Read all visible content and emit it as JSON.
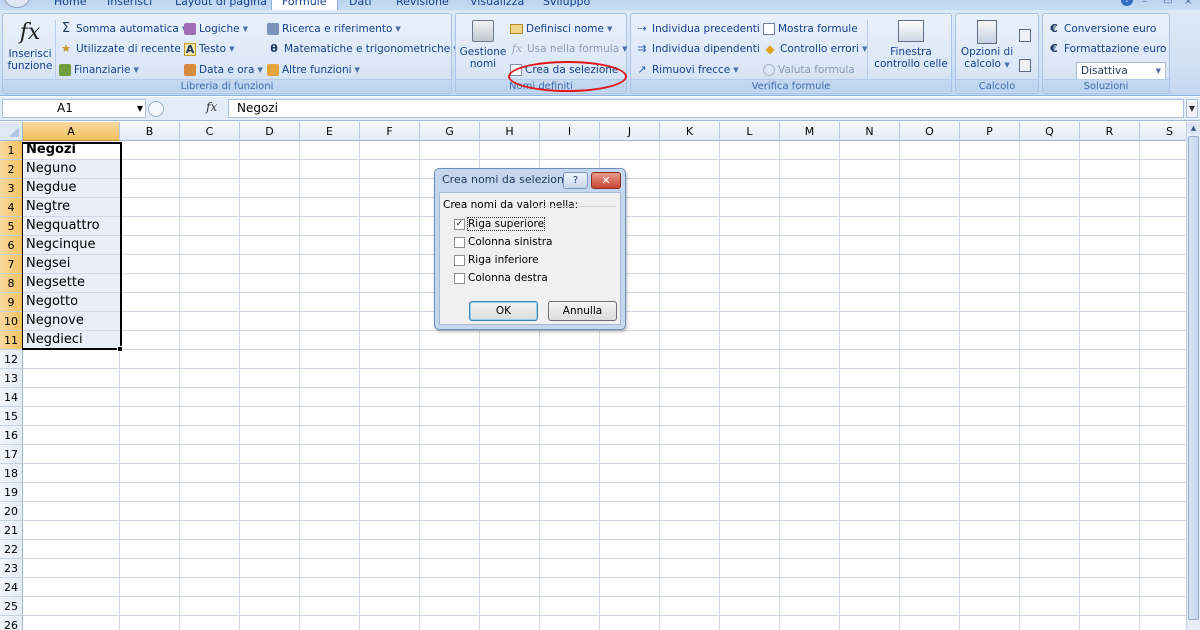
{
  "tabs": [
    {
      "label": "Home"
    },
    {
      "label": "Inserisci"
    },
    {
      "label": "Layout di pagina"
    },
    {
      "label": "Formule",
      "active": true
    },
    {
      "label": "Dati"
    },
    {
      "label": "Revisione"
    },
    {
      "label": "Visualizza"
    },
    {
      "label": "Sviluppo"
    }
  ],
  "window_controls": {
    "minimize": "–",
    "restore": "▭",
    "close": "×"
  },
  "help_glyph": "?",
  "ribbon": {
    "libreria": {
      "label": "Libreria di funzioni",
      "inserisci_funzione": {
        "line1": "Inserisci",
        "line2": "funzione",
        "icon": "fx-icon"
      },
      "somma_automatica": "Somma automatica",
      "utilizzate_di_recente": "Utilizzate di recente",
      "finanziarie": "Finanziarie",
      "logiche": "Logiche",
      "testo": "Testo",
      "data_e_ora": "Data e ora",
      "ricerca_e_riferimento": "Ricerca e riferimento",
      "matematiche": "Matematiche e trigonometriche",
      "altre_funzioni": "Altre funzioni"
    },
    "nomi": {
      "label": "Nomi definiti",
      "gestione_nomi": {
        "line1": "Gestione",
        "line2": "nomi"
      },
      "definisci_nome": "Definisci nome",
      "usa_nella_formula": "Usa nella formula",
      "crea_da_selezione": "Crea da selezione"
    },
    "verifica": {
      "label": "Verifica formule",
      "individua_precedenti": "Individua precedenti",
      "individua_dipendenti": "Individua dipendenti",
      "rimuovi_frecce": "Rimuovi frecce",
      "mostra_formule": "Mostra formule",
      "controllo_errori": "Controllo errori",
      "valuta_formula": "Valuta formula",
      "finestra": {
        "line1": "Finestra",
        "line2": "controllo celle"
      }
    },
    "calcolo": {
      "label": "Calcolo",
      "opzioni": {
        "line1": "Opzioni di",
        "line2": "calcolo"
      }
    },
    "soluzioni": {
      "label": "Soluzioni",
      "conversione_euro": "Conversione euro",
      "formattazione_euro": "Formattazione euro",
      "dropdown_value": "Disattiva"
    }
  },
  "formula_bar": {
    "name_box": "A1",
    "fx_label": "fx",
    "formula": "Negozi"
  },
  "sheet": {
    "columns": [
      "A",
      "B",
      "C",
      "D",
      "E",
      "F",
      "G",
      "H",
      "I",
      "J",
      "K",
      "L",
      "M",
      "N",
      "O",
      "P",
      "Q",
      "R",
      "S"
    ],
    "rows": [
      "1",
      "2",
      "3",
      "4",
      "5",
      "6",
      "7",
      "8",
      "9",
      "10",
      "11",
      "12",
      "13",
      "14",
      "15",
      "16",
      "17",
      "18",
      "19",
      "20",
      "21",
      "22",
      "23",
      "24",
      "25",
      "26"
    ],
    "column_a_values": [
      "Negozi",
      "Neguno",
      "Negdue",
      "Negtre",
      "Negquattro",
      "Negcinque",
      "Negsei",
      "Negsette",
      "Negotto",
      "Negnove",
      "Negdieci"
    ]
  },
  "dialog": {
    "title": "Crea nomi da selezione",
    "help": "?",
    "close": "✕",
    "group_label": "Crea nomi da valori nella:",
    "options": [
      {
        "label": "Riga superiore",
        "checked": "✓"
      },
      {
        "label": "Colonna sinistra",
        "checked": ""
      },
      {
        "label": "Riga inferiore",
        "checked": ""
      },
      {
        "label": "Colonna destra",
        "checked": ""
      }
    ],
    "ok": "OK",
    "cancel": "Annulla"
  },
  "colors": {
    "annotation": "#e0161b",
    "selected_header": "#f1c15f",
    "ribbon": "#dbe7f6"
  }
}
